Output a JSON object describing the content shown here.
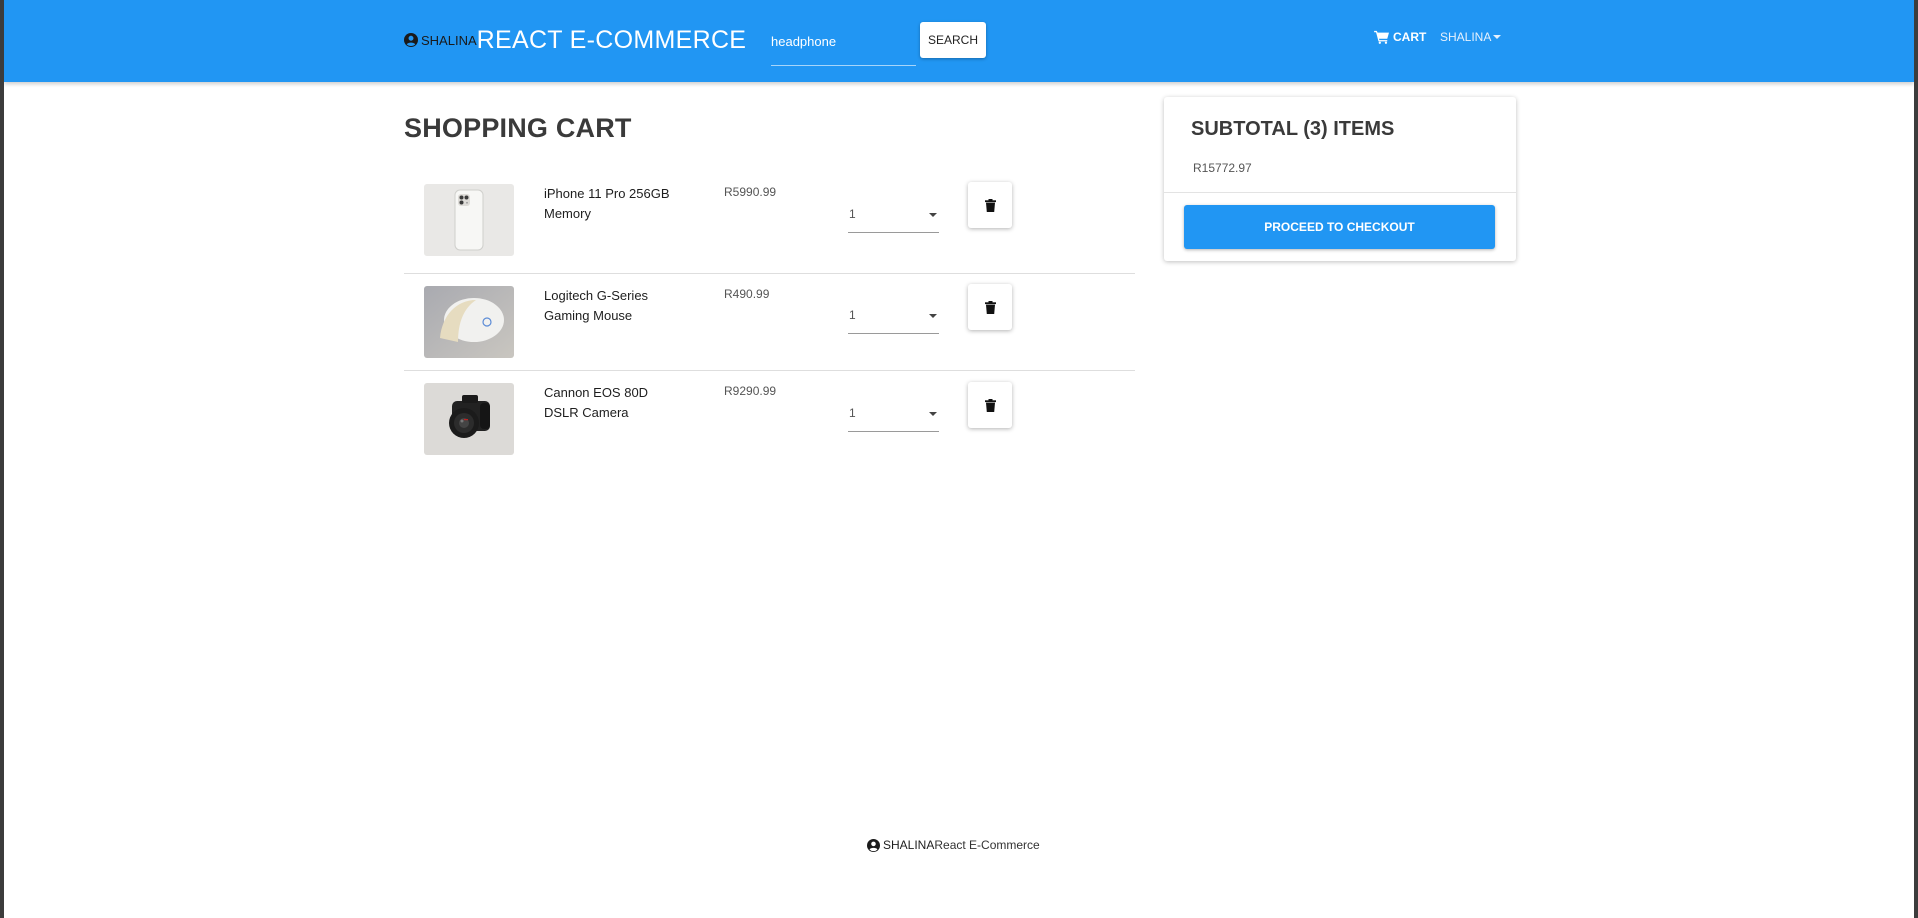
{
  "navbar": {
    "brand_user": "SHALINA",
    "brand_title": "REACT E-COMMERCE",
    "search_value": "headphone",
    "search_button": "SEARCH",
    "cart_label": "CART",
    "user_label": "SHALINA",
    "bg_color": "#2196f3"
  },
  "main": {
    "title": "SHOPPING CART",
    "items": [
      {
        "name": "iPhone 11 Pro 256GB Memory",
        "price": "R5990.99",
        "qty": "1",
        "image": "iphone-image"
      },
      {
        "name": "Logitech G-Series Gaming Mouse",
        "price": "R490.99",
        "qty": "1",
        "image": "mouse-image"
      },
      {
        "name": "Cannon EOS 80D DSLR Camera",
        "price": "R9290.99",
        "qty": "1",
        "image": "camera-image"
      }
    ]
  },
  "summary": {
    "title": "SUBTOTAL (3) ITEMS",
    "total": "R15772.97",
    "checkout_button": "PROCEED TO CHECKOUT"
  },
  "footer": {
    "user": "SHALINA",
    "title": "React E-Commerce"
  },
  "icons": {
    "user": "user-circle-icon",
    "cart": "shopping-cart-icon",
    "delete": "trash-icon",
    "dropdown": "caret-down-icon"
  }
}
